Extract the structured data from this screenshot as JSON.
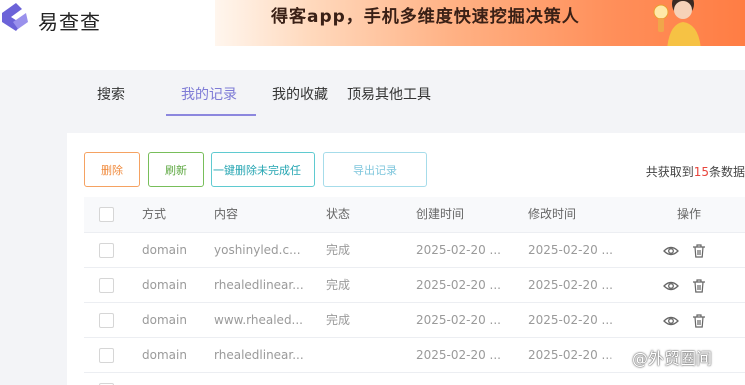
{
  "app": {
    "name": "易查查"
  },
  "banner": {
    "text": "得客app，手机多维度快速挖掘决策人"
  },
  "tabs": [
    {
      "label": "搜索"
    },
    {
      "label": "我的记录"
    },
    {
      "label": "我的收藏"
    },
    {
      "label": "顶易其他工具"
    }
  ],
  "toolbar": {
    "delete_label": "删除",
    "refresh_label": "刷新",
    "clear_unfinished_label": "一键删除未完成任",
    "export_label": "导出记录"
  },
  "total": {
    "prefix": "共获取到",
    "count": "15",
    "suffix": "条数据"
  },
  "table": {
    "headers": {
      "method": "方式",
      "content": "内容",
      "status": "状态",
      "created": "创建时间",
      "modified": "修改时间",
      "actions": "操作"
    },
    "rows": [
      {
        "method": "domain",
        "content": "yoshinyled.c...",
        "status": "完成",
        "created": "2025-02-20 ...",
        "modified": "2025-02-20 ..."
      },
      {
        "method": "domain",
        "content": "rhealedlinear...",
        "status": "完成",
        "created": "2025-02-20 ...",
        "modified": "2025-02-20 ..."
      },
      {
        "method": "domain",
        "content": "www.rhealed...",
        "status": "完成",
        "created": "2025-02-20 ...",
        "modified": "2025-02-20 ..."
      },
      {
        "method": "domain",
        "content": "rhealedlinear...",
        "status": "",
        "created": "2025-02-20 ...",
        "modified": "2025-02-20 ..."
      }
    ]
  },
  "watermark": {
    "text": "@外贸圈间"
  },
  "colors": {
    "accent": "#7e7bd6",
    "danger_count": "#e8453c"
  }
}
